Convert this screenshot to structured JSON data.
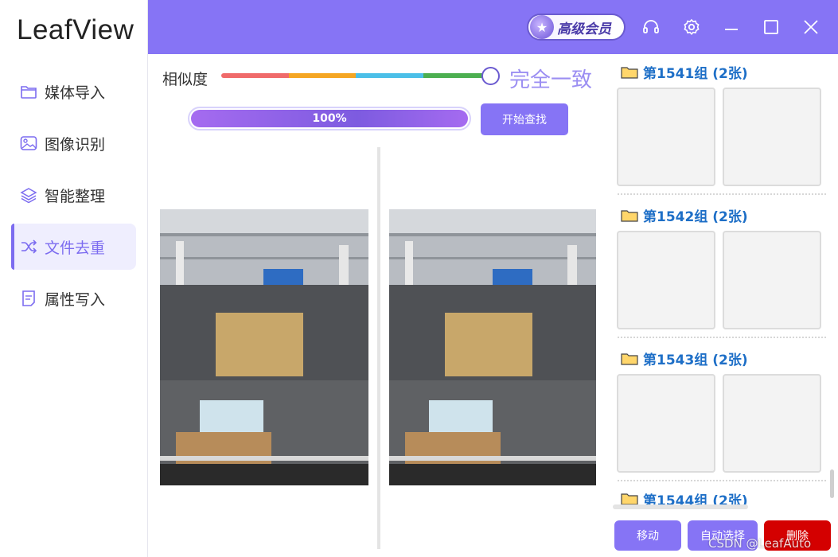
{
  "app": {
    "title": "LeafView"
  },
  "sidebar": {
    "items": [
      {
        "label": "媒体导入",
        "icon": "folder-icon",
        "active": false
      },
      {
        "label": "图像识别",
        "icon": "image-icon",
        "active": false
      },
      {
        "label": "智能整理",
        "icon": "layers-icon",
        "active": false
      },
      {
        "label": "文件去重",
        "icon": "shuffle-icon",
        "active": true
      },
      {
        "label": "属性写入",
        "icon": "document-icon",
        "active": false
      }
    ]
  },
  "header": {
    "vip_label": "高级会员",
    "icons": [
      "headset-icon",
      "gear-icon",
      "minimize-icon",
      "maximize-icon",
      "close-icon"
    ]
  },
  "controls": {
    "similarity_label": "相似度",
    "similarity_value_text": "完全一致",
    "slider_level": 1.0,
    "slider_colors": [
      "#f06a6a",
      "#f5a623",
      "#4bbfe8",
      "#4caf50"
    ],
    "progress_text": "100%",
    "progress_value": 1.0,
    "start_button": "开始查找"
  },
  "groups": [
    {
      "title": "第1541组 (2张)",
      "count": 2
    },
    {
      "title": "第1542组 (2张)",
      "count": 2
    },
    {
      "title": "第1543组 (2张)",
      "count": 2
    },
    {
      "title": "第1544组 (2张)",
      "count": 2
    }
  ],
  "actions": {
    "move": "移动",
    "auto_select": "自动选择",
    "delete": "删除"
  },
  "watermark": "CSDN @LeafAuto",
  "colors": {
    "accent": "#8674f5",
    "delete": "#d40000",
    "group_title": "#1e6fc7"
  }
}
